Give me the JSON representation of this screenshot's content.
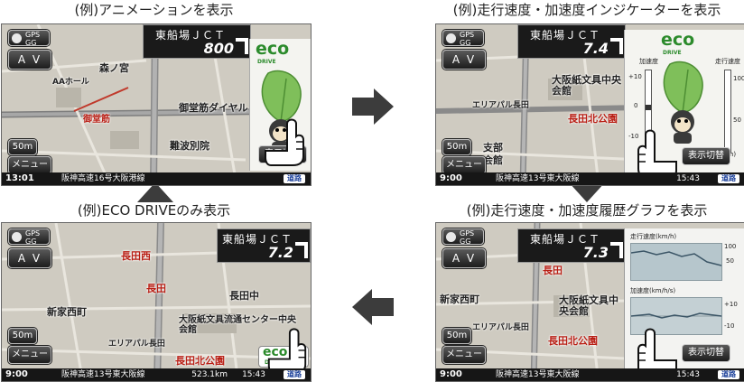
{
  "captions": {
    "tl": "(例)アニメーションを表示",
    "tr": "(例)走行速度・加速度インジケーターを表示",
    "bl": "(例)ECO DRIVEのみ表示",
    "br": "(例)走行速度・加速度履歴グラフを表示"
  },
  "common": {
    "gps_line1": "GPS",
    "gps_line2": "GG",
    "av_label": "A V",
    "scale": "50m",
    "menu": "メニュー",
    "switch_label": "表示切替",
    "nav_badge": "道路",
    "eco": "eco",
    "eco_sub": "DRIVE",
    "jct_name": "東船場ＪＣＴ"
  },
  "screen_tl": {
    "distance": "800",
    "clock": "13:01",
    "road": "阪神高速16号大阪港線",
    "map_labels": [
      "森ノ宮",
      "AAホール",
      "御堂筋ダイヤル",
      "難波別院",
      "御堂筋"
    ]
  },
  "screen_tr": {
    "distance": "7.4",
    "clock": "9:00",
    "road": "阪神高速13号東大阪線",
    "time": "15:43",
    "accel_label": "加速度",
    "speed_label": "走行速度",
    "accel_ticks": [
      "+10",
      "0",
      "-10"
    ],
    "speed_ticks": [
      "100",
      "50",
      "(km/h)"
    ],
    "map_labels": [
      "大阪紙文具中央会館",
      "長田北公園",
      "エリアパル長田",
      "支部",
      "会館"
    ]
  },
  "screen_bl": {
    "distance": "7.2",
    "clock": "9:00",
    "road": "阪神高速13号東大阪線",
    "dist_text": "523.1km",
    "time": "15:43",
    "map_labels": [
      "長田西",
      "長田",
      "長田中",
      "新家西町",
      "大阪紙文具流通センター中央会館",
      "エリアパル長田",
      "長田北公園"
    ]
  },
  "screen_br": {
    "distance": "7.3",
    "clock": "9:00",
    "road": "阪神高速13号東大阪線",
    "time": "15:43",
    "speed_graph_label": "走行速度(km/h)",
    "accel_graph_label": "加速度(km/h/s)",
    "speed_ticks": [
      "100",
      "50"
    ],
    "accel_ticks": [
      "+10",
      "-10"
    ],
    "map_labels": [
      "長田",
      "新家西町",
      "大阪紙文具中央会館",
      "エリアパル長田",
      "長田北公園"
    ]
  },
  "colors": {
    "eco_green": "#2c8b2c",
    "arrow": "#3c3c3c",
    "nav_blue": "#1a3f99"
  },
  "icons": [
    "gps-icon",
    "direction-arrow-icon",
    "pointing-hand-icon",
    "leaf-icon",
    "mascot-icon",
    "car-position-icon"
  ]
}
